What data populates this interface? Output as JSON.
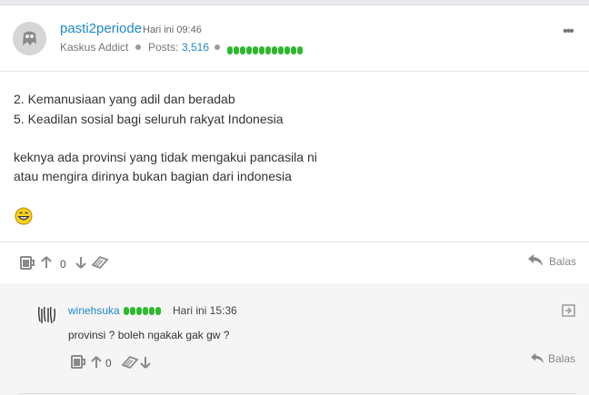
{
  "post": {
    "username": "pasti2periode",
    "time": "Hari ini 09:46",
    "rank": "Kaskus Addict",
    "posts_label": "Posts:",
    "posts_count": "3,516",
    "reputation_colors": [
      "#2eb82e"
    ],
    "lines": [
      "2. Kemanusiaan yang adil dan beradab",
      "5. Keadilan sosial bagi seluruh rakyat Indonesia",
      "keknya ada provinsi yang tidak mengakui pancasila ni",
      "atau mengira dirinya bukan bagian dari indonesia"
    ],
    "vote_count": "0",
    "reply_label": "Balas"
  },
  "comment": {
    "username": "winehsuka",
    "time": "Hari ini 15:36",
    "text": "provinsi ? boleh ngakak gak gw ?",
    "vote_count": "0",
    "reply_label": "Balas"
  },
  "icons": {
    "more": "more-dots-icon",
    "quote": "quote-mug-icon",
    "upvote": "arrow-up-icon",
    "downvote": "arrow-down-icon",
    "cendol": "cendol-tag-icon",
    "reply": "reply-arrow-icon",
    "expand": "expand-arrow-icon",
    "emoji": "grinning-emoji-icon"
  }
}
